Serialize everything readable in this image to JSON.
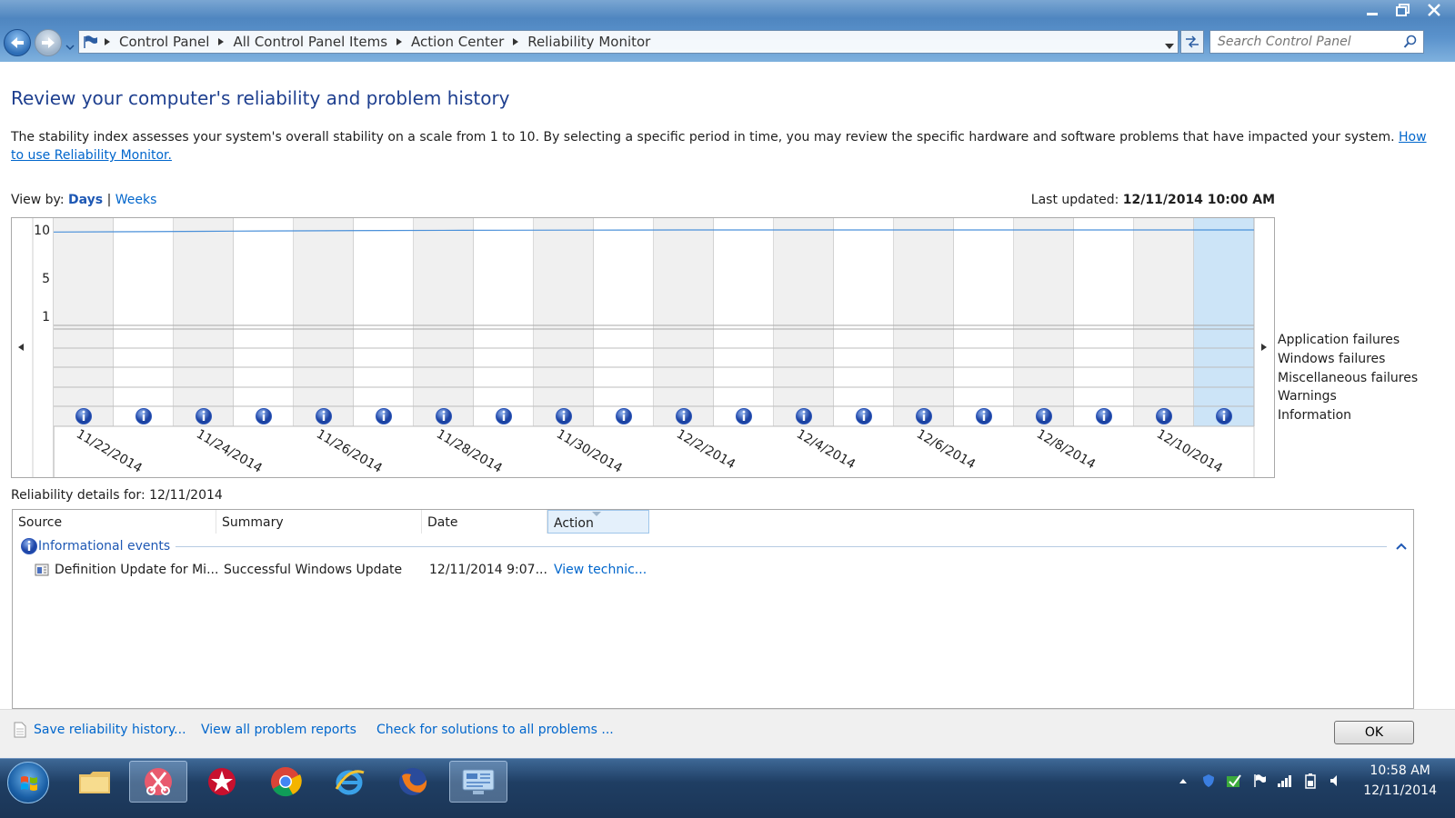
{
  "window": {
    "minimize_icon": "minimize-icon",
    "maximize_icon": "maximize-icon",
    "close_icon": "close-icon"
  },
  "address_bar": {
    "breadcrumbs": [
      "Control Panel",
      "All Control Panel Items",
      "Action Center",
      "Reliability Monitor"
    ]
  },
  "search": {
    "placeholder": "Search Control Panel"
  },
  "page": {
    "title": "Review your computer's reliability and problem history",
    "description": "The stability index assesses your system's overall stability on a scale from 1 to 10. By selecting a specific period in time, you may review the specific hardware and software problems that have impacted your system.",
    "help_link": "How to use Reliability Monitor.",
    "view_by_label": "View by:",
    "view_days": "Days",
    "view_separator": "|",
    "view_weeks": "Weeks",
    "last_updated_label": "Last updated:",
    "last_updated_value": "12/11/2014 10:00 AM"
  },
  "chart_data": {
    "type": "line",
    "y_ticks": [
      "10",
      "5",
      "1"
    ],
    "ylim": [
      1,
      10
    ],
    "columns": 20,
    "selected_index": 19,
    "date_labels": [
      "11/22/2014",
      "11/24/2014",
      "11/26/2014",
      "11/28/2014",
      "11/30/2014",
      "12/2/2014",
      "12/4/2014",
      "12/6/2014",
      "12/8/2014",
      "12/10/2014"
    ],
    "stability_index": [
      9.78,
      9.82,
      9.86,
      9.89,
      9.92,
      9.94,
      9.96,
      9.97,
      9.98,
      9.99,
      10,
      10,
      10,
      10,
      10,
      10,
      10,
      10,
      10,
      10
    ],
    "information_events": [
      1,
      1,
      1,
      1,
      1,
      1,
      1,
      1,
      1,
      1,
      1,
      1,
      1,
      1,
      1,
      1,
      1,
      1,
      1,
      1
    ],
    "legend": [
      "Application failures",
      "Windows failures",
      "Miscellaneous failures",
      "Warnings",
      "Information"
    ],
    "colors": {
      "line": "#4a90d9",
      "shade": "#f0f0f0",
      "selected": "#cce4f7",
      "info_icon": "#2b55b8"
    }
  },
  "details": {
    "label": "Reliability details for: 12/11/2014",
    "columns": [
      "Source",
      "Summary",
      "Date",
      "Action"
    ],
    "group_title": "Informational events",
    "rows": [
      {
        "source": "Definition Update for Mi...",
        "summary": "Successful Windows Update",
        "date": "12/11/2014 9:07...",
        "action": "View  technic..."
      }
    ]
  },
  "footer": {
    "save_link": "Save reliability history...",
    "reports_link": "View all problem reports",
    "solutions_link": "Check for solutions to all problems ...",
    "ok_label": "OK"
  },
  "taskbar": {
    "apps": [
      "file-explorer-icon",
      "snipping-tool-icon",
      "pokerstars-icon",
      "chrome-icon",
      "internet-explorer-icon",
      "firefox-icon",
      "control-panel-icon"
    ],
    "clock_time": "10:58 AM",
    "clock_date": "12/11/2014"
  }
}
